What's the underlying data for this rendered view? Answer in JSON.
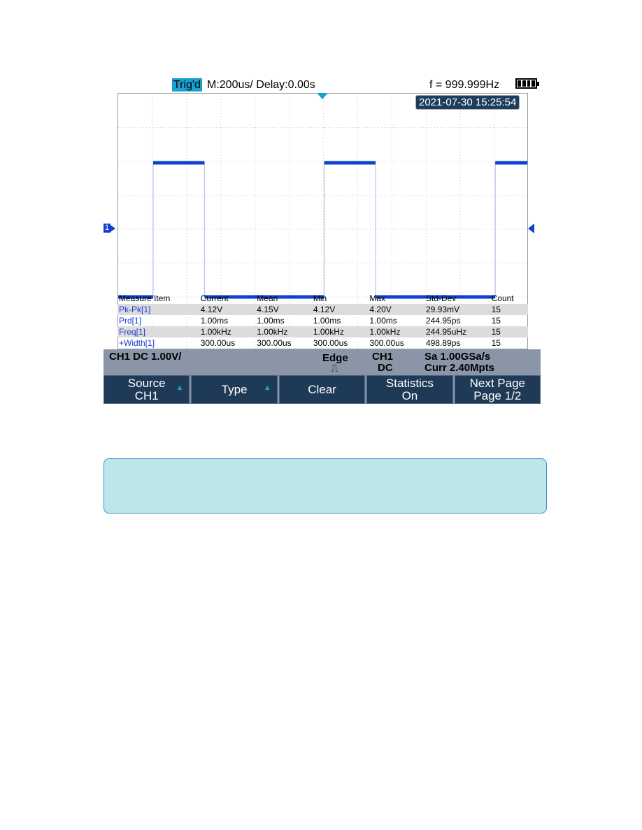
{
  "header": {
    "trigger_status": "Trig'd",
    "timebase": "M:200us/ Delay:0.00s",
    "frequency": "f = 999.999Hz",
    "battery": "full"
  },
  "screen": {
    "datetime": "2021-07-30 15:25:54",
    "channel_marker": "1"
  },
  "waveform": {
    "type": "square",
    "color": "#1040d0",
    "period_ms": 1.0,
    "high_width_us": 300
  },
  "measure_table": {
    "headers": [
      "Measure Item",
      "Current",
      "Mean",
      "Min",
      "Max",
      "Std-Dev",
      "Count"
    ],
    "rows": [
      [
        "Pk-Pk[1]",
        "4.12V",
        "4.15V",
        "4.12V",
        "4.20V",
        "29.93mV",
        "15"
      ],
      [
        "Prd[1]",
        "1.00ms",
        "1.00ms",
        "1.00ms",
        "1.00ms",
        "244.95ps",
        "15"
      ],
      [
        "Freq[1]",
        "1.00kHz",
        "1.00kHz",
        "1.00kHz",
        "1.00kHz",
        "244.95uHz",
        "15"
      ],
      [
        "+Width[1]",
        "300.00us",
        "300.00us",
        "300.00us",
        "300.00us",
        "498.89ps",
        "15"
      ]
    ]
  },
  "status": {
    "channel": "CH1 DC 1.00V/",
    "trigger_type": "Edge",
    "trigger_slope": "rising",
    "trigger_source": "CH1",
    "trigger_coupling": "DC",
    "sample_rate": "Sa 1.00GSa/s",
    "memory": "Curr 2.40Mpts"
  },
  "softkeys": [
    {
      "line1": "Source",
      "line2": "CH1",
      "arrow": true
    },
    {
      "line1": "Type",
      "line2": "",
      "arrow": true
    },
    {
      "line1": "Clear",
      "line2": "",
      "arrow": false
    },
    {
      "line1": "Statistics",
      "line2": "On",
      "arrow": false
    },
    {
      "line1": "Next Page",
      "line2": "Page 1/2",
      "arrow": false
    }
  ]
}
